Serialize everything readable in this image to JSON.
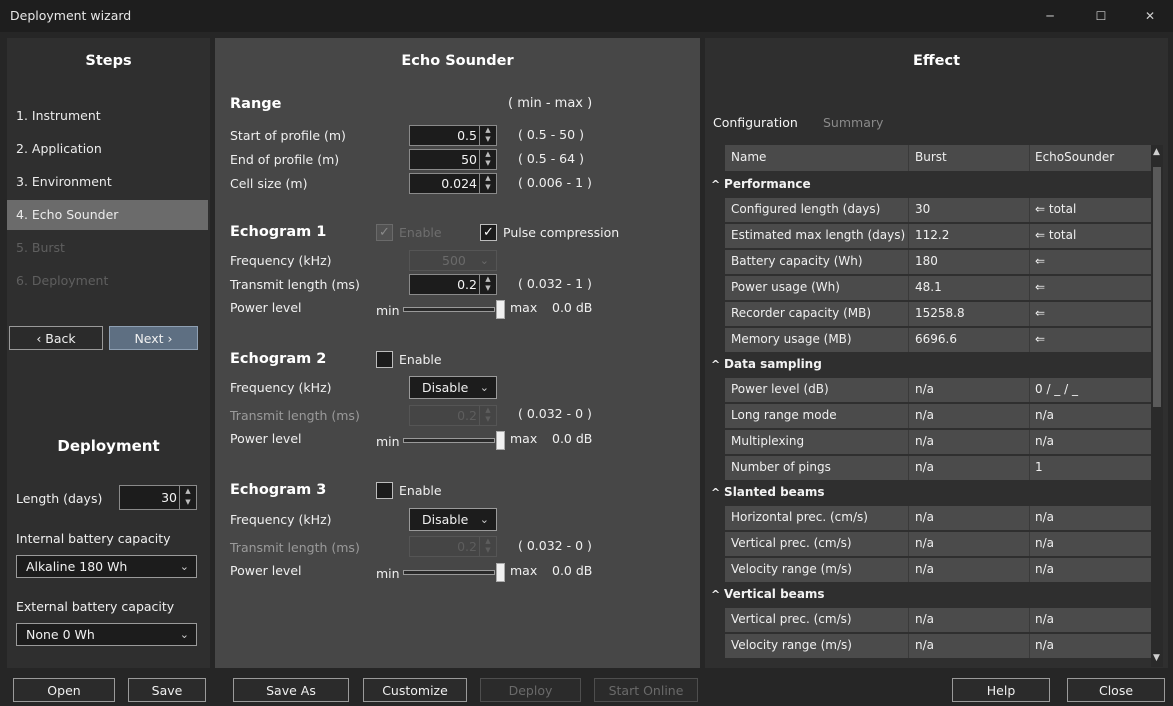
{
  "window": {
    "title": "Deployment wizard",
    "minimize": "─",
    "maximize": "☐",
    "close": "✕"
  },
  "steps": {
    "header": "Steps",
    "items": [
      "1. Instrument",
      "2. Application",
      "3. Environment",
      "4. Echo Sounder",
      "5. Burst",
      "6. Deployment"
    ],
    "back": "‹ Back",
    "next": "Next ›"
  },
  "deployment": {
    "header": "Deployment",
    "length_label": "Length (days)",
    "length_value": "30",
    "internal_label": "Internal battery capacity",
    "internal_value": "Alkaline 180 Wh",
    "external_label": "External battery capacity",
    "external_value": "None 0 Wh"
  },
  "echo": {
    "header": "Echo Sounder",
    "range": {
      "title": "Range",
      "minmax": "( min - max )",
      "rows": [
        {
          "label": "Start of profile (m)",
          "value": "0.5",
          "range": "( 0.5 - 50 )"
        },
        {
          "label": "End of profile (m)",
          "value": "50",
          "range": "( 0.5 - 64 )"
        },
        {
          "label": "Cell size (m)",
          "value": "0.024",
          "range": "( 0.006 - 1 )"
        }
      ]
    },
    "echograms": [
      {
        "title": "Echogram 1",
        "enable": "Enable",
        "pulse": "Pulse compression",
        "freq_label": "Frequency (kHz)",
        "freq_value": "500",
        "tx_label": "Transmit length (ms)",
        "tx_value": "0.2",
        "tx_range": "( 0.032 - 1 )",
        "power_label": "Power level",
        "min": "min",
        "max": "max",
        "db": "0.0 dB"
      },
      {
        "title": "Echogram 2",
        "enable": "Enable",
        "freq_label": "Frequency (kHz)",
        "freq_value": "Disable",
        "tx_label": "Transmit length (ms)",
        "tx_value": "0.2",
        "tx_range": "( 0.032 - 0 )",
        "power_label": "Power level",
        "min": "min",
        "max": "max",
        "db": "0.0 dB"
      },
      {
        "title": "Echogram 3",
        "enable": "Enable",
        "freq_label": "Frequency (kHz)",
        "freq_value": "Disable",
        "tx_label": "Transmit length (ms)",
        "tx_value": "0.2",
        "tx_range": "( 0.032 - 0 )",
        "power_label": "Power level",
        "min": "min",
        "max": "max",
        "db": "0.0 dB"
      }
    ]
  },
  "effect": {
    "header": "Effect",
    "tabs": [
      "Configuration",
      "Summary"
    ],
    "columns": [
      "Name",
      "Burst",
      "EchoSounder"
    ],
    "groups": [
      {
        "name": "Performance",
        "rows": [
          [
            "Configured length (days)",
            "30",
            "⇐ total"
          ],
          [
            "Estimated max length (days)",
            "112.2",
            "⇐ total"
          ],
          [
            "Battery capacity (Wh)",
            "180",
            "⇐"
          ],
          [
            "Power usage (Wh)",
            "48.1",
            "⇐"
          ],
          [
            "Recorder capacity (MB)",
            "15258.8",
            "⇐"
          ],
          [
            "Memory usage (MB)",
            "6696.6",
            "⇐"
          ]
        ]
      },
      {
        "name": "Data sampling",
        "rows": [
          [
            "Power level (dB)",
            "n/a",
            "0 / _ / _"
          ],
          [
            "Long range mode",
            "n/a",
            "n/a"
          ],
          [
            "Multiplexing",
            "n/a",
            "n/a"
          ],
          [
            "Number of pings",
            "n/a",
            "1"
          ]
        ]
      },
      {
        "name": "Slanted beams",
        "rows": [
          [
            "Horizontal prec. (cm/s)",
            "n/a",
            "n/a"
          ],
          [
            "Vertical prec. (cm/s)",
            "n/a",
            "n/a"
          ],
          [
            "Velocity range (m/s)",
            "n/a",
            "n/a"
          ]
        ]
      },
      {
        "name": "Vertical beams",
        "rows": [
          [
            "Vertical prec. (cm/s)",
            "n/a",
            "n/a"
          ],
          [
            "Velocity range (m/s)",
            "n/a",
            "n/a"
          ]
        ]
      }
    ]
  },
  "bottom": {
    "open": "Open",
    "save": "Save",
    "save_as": "Save As",
    "customize": "Customize",
    "deploy": "Deploy",
    "start_online": "Start Online",
    "help": "Help",
    "close": "Close"
  },
  "colors": {
    "panel": "#2f2f2f",
    "middle": "#474747",
    "active_step": "#6b6b6b",
    "next_button": "#5e6f82"
  }
}
